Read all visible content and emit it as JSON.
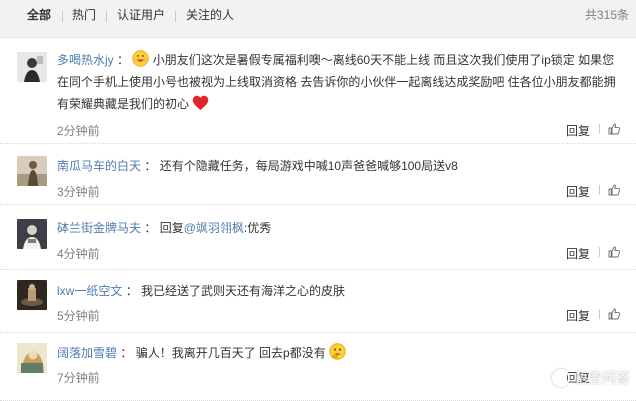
{
  "filters": {
    "tabs": [
      "全部",
      "热门",
      "认证用户",
      "关注的人"
    ],
    "total": "共315条"
  },
  "comments": [
    {
      "user": "多喝热水jy",
      "text_before_emoji": "",
      "text": "小朋友们这次是暑假专属福利噢～离线60天不能上线 而且这次我们使用了ip锁定 如果您在同个手机上使用小号也被视为上线取消资格 去告诉你的小伙伴一起离线达成奖励吧 住各位小朋友都能拥有荣耀典藏是我们的初心",
      "time": "2分钟前",
      "reply": "回复"
    },
    {
      "user": "南瓜马车的白天",
      "text": "还有个隐藏任务，每局游戏中喊10声爸爸喊够100局送v8",
      "time": "3分钟前",
      "reply": "回复"
    },
    {
      "user": "砵兰街金牌马夫",
      "reply_prefix": "回复",
      "mention": "@飒羽翎枫",
      "text": ":优秀",
      "time": "4分钟前",
      "reply": "回复"
    },
    {
      "user": "lxw一纸空文",
      "text": "我已经送了武则天还有海洋之心的皮肤",
      "time": "5分钟前",
      "reply": "回复"
    },
    {
      "user": "阔落加雪碧",
      "text": "骗人！我离开几百天了 回去p都没有",
      "time": "7分钟前",
      "reply": "回复"
    }
  ],
  "watermark": "悟空问答",
  "icons": {
    "emoji_smile": "smile-emoji-icon",
    "heart": "red-heart-icon",
    "emoji_think": "thinking-emoji-icon",
    "like": "thumbs-up-icon"
  },
  "colors": {
    "username": "#507daf",
    "text": "#333333",
    "muted": "#808080",
    "filter_bg": "#f2f2f5",
    "heart": "#e0262b"
  }
}
